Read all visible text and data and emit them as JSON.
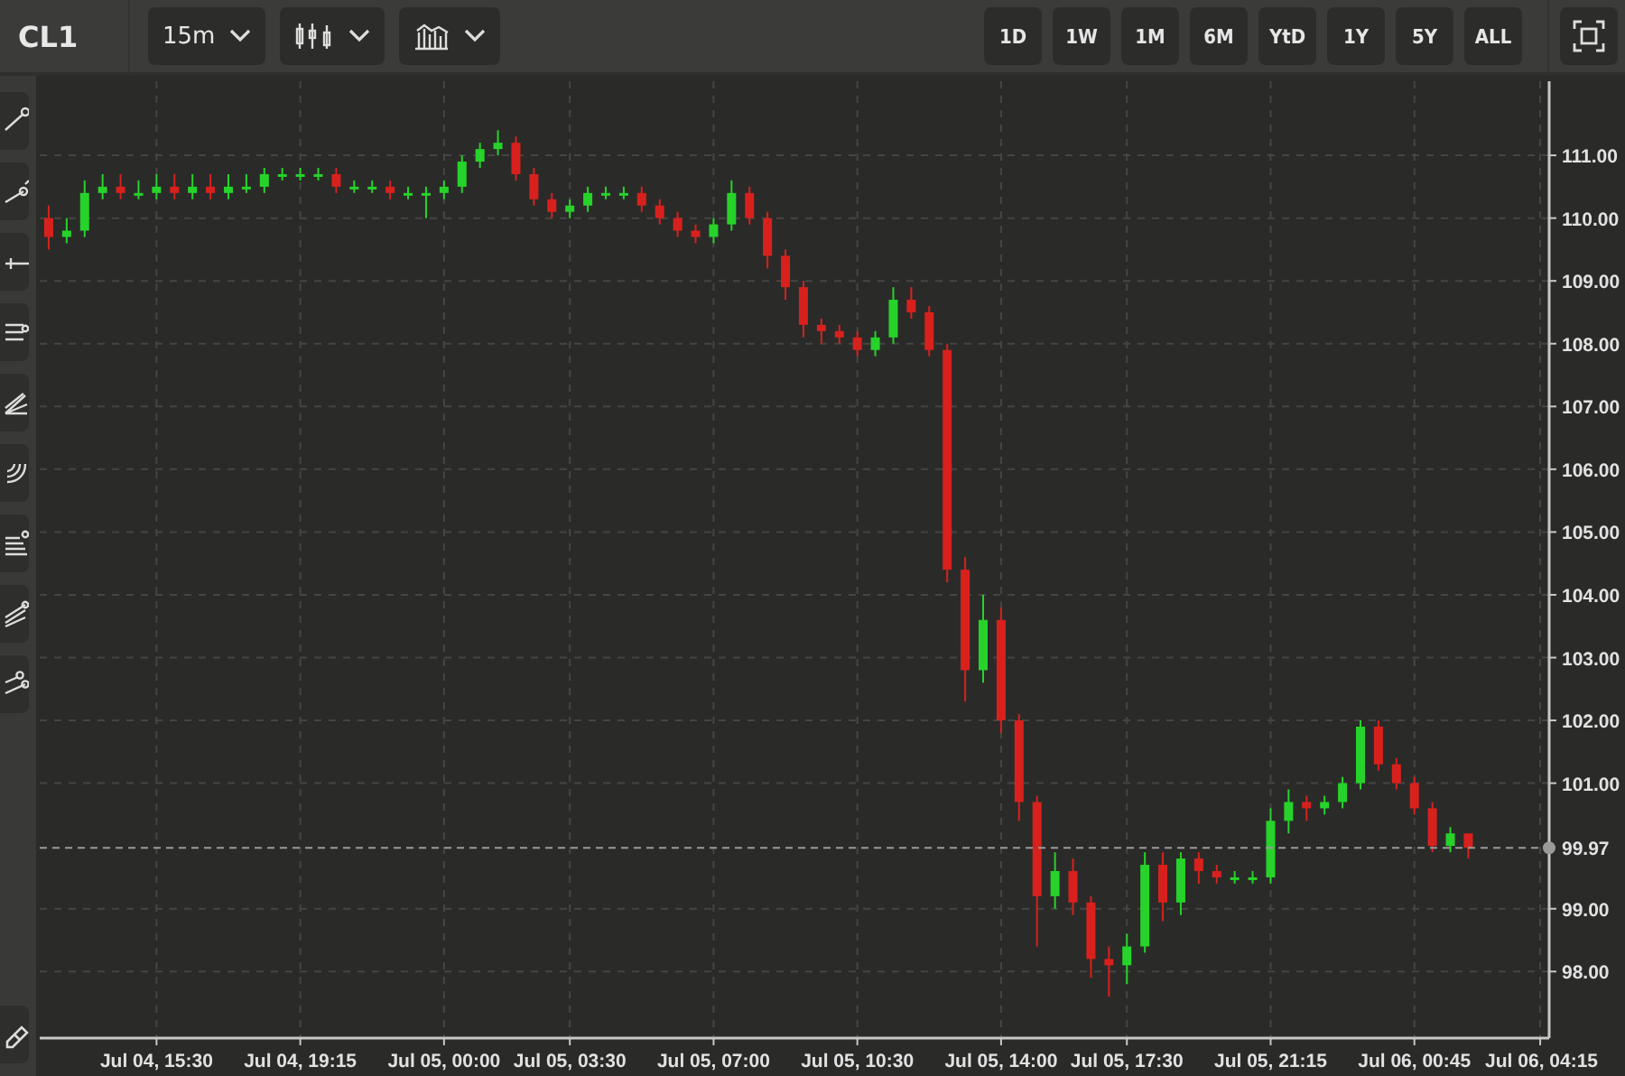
{
  "symbol": "CL1",
  "interval": {
    "label": "15m"
  },
  "ranges": [
    {
      "label": "1D",
      "selected": false
    },
    {
      "label": "1W",
      "selected": false
    },
    {
      "label": "1M",
      "selected": false
    },
    {
      "label": "6M",
      "selected": false
    },
    {
      "label": "YtD",
      "selected": false
    },
    {
      "label": "1Y",
      "selected": false
    },
    {
      "label": "5Y",
      "selected": false
    },
    {
      "label": "ALL",
      "selected": false
    }
  ],
  "chart_data": {
    "type": "candlestick",
    "ylim": [
      96.94,
      112.18
    ],
    "grid": true,
    "ref_lines": [
      {
        "axis": "y",
        "value": 99.97,
        "label": "99.97"
      }
    ],
    "yticks": [
      {
        "value": 98,
        "label": "98.00"
      },
      {
        "value": 99,
        "label": "99.00"
      },
      {
        "value": 101,
        "label": "101.00"
      },
      {
        "value": 102,
        "label": "102.00"
      },
      {
        "value": 103,
        "label": "103.00"
      },
      {
        "value": 104,
        "label": "104.00"
      },
      {
        "value": 105,
        "label": "105.00"
      },
      {
        "value": 106,
        "label": "106.00"
      },
      {
        "value": 107,
        "label": "107.00"
      },
      {
        "value": 108,
        "label": "108.00"
      },
      {
        "value": 109,
        "label": "109.00"
      },
      {
        "value": 110,
        "label": "110.00"
      },
      {
        "value": 111,
        "label": "111.00"
      }
    ],
    "categories": [
      null,
      null,
      null,
      null,
      null,
      null,
      "Jul 04, 15:30",
      null,
      null,
      null,
      null,
      null,
      null,
      null,
      "Jul 04, 19:15",
      null,
      null,
      null,
      null,
      null,
      null,
      null,
      "Jul 05, 00:00",
      null,
      null,
      null,
      null,
      null,
      null,
      "Jul 05, 03:30",
      null,
      null,
      null,
      null,
      null,
      null,
      null,
      "Jul 05, 07:00",
      null,
      null,
      null,
      null,
      null,
      null,
      null,
      "Jul 05, 10:30",
      null,
      null,
      null,
      null,
      null,
      null,
      null,
      "Jul 05, 14:00",
      null,
      null,
      null,
      null,
      null,
      null,
      "Jul 05, 17:30",
      null,
      null,
      null,
      null,
      null,
      null,
      null,
      "Jul 05, 21:15",
      null,
      null,
      null,
      null,
      null,
      null,
      null,
      "Jul 06, 00:45",
      null,
      null,
      null,
      null,
      null,
      null,
      "Jul 06, 04:15"
    ],
    "ohlc": [
      [
        110.0,
        110.2,
        109.5,
        109.7
      ],
      [
        109.7,
        110.0,
        109.6,
        109.8
      ],
      [
        109.8,
        110.6,
        109.7,
        110.4
      ],
      [
        110.4,
        110.7,
        110.3,
        110.5
      ],
      [
        110.5,
        110.7,
        110.3,
        110.4
      ],
      [
        110.4,
        110.6,
        110.3,
        110.4
      ],
      [
        110.4,
        110.7,
        110.3,
        110.5
      ],
      [
        110.5,
        110.7,
        110.3,
        110.4
      ],
      [
        110.4,
        110.7,
        110.3,
        110.5
      ],
      [
        110.5,
        110.7,
        110.3,
        110.4
      ],
      [
        110.4,
        110.7,
        110.3,
        110.5
      ],
      [
        110.5,
        110.7,
        110.4,
        110.5
      ],
      [
        110.5,
        110.8,
        110.4,
        110.7
      ],
      [
        110.7,
        110.8,
        110.6,
        110.7
      ],
      [
        110.7,
        110.8,
        110.6,
        110.7
      ],
      [
        110.7,
        110.8,
        110.6,
        110.7
      ],
      [
        110.7,
        110.8,
        110.4,
        110.5
      ],
      [
        110.5,
        110.6,
        110.4,
        110.5
      ],
      [
        110.5,
        110.6,
        110.4,
        110.5
      ],
      [
        110.5,
        110.6,
        110.3,
        110.4
      ],
      [
        110.4,
        110.5,
        110.3,
        110.4
      ],
      [
        110.4,
        110.5,
        110.0,
        110.4
      ],
      [
        110.4,
        110.6,
        110.3,
        110.5
      ],
      [
        110.5,
        111.0,
        110.4,
        110.9
      ],
      [
        110.9,
        111.2,
        110.8,
        111.1
      ],
      [
        111.1,
        111.4,
        111.0,
        111.2
      ],
      [
        111.2,
        111.3,
        110.6,
        110.7
      ],
      [
        110.7,
        110.8,
        110.2,
        110.3
      ],
      [
        110.3,
        110.4,
        110.0,
        110.1
      ],
      [
        110.1,
        110.3,
        110.0,
        110.2
      ],
      [
        110.2,
        110.5,
        110.1,
        110.4
      ],
      [
        110.4,
        110.5,
        110.3,
        110.4
      ],
      [
        110.4,
        110.5,
        110.3,
        110.4
      ],
      [
        110.4,
        110.5,
        110.1,
        110.2
      ],
      [
        110.2,
        110.3,
        109.9,
        110.0
      ],
      [
        110.0,
        110.1,
        109.7,
        109.8
      ],
      [
        109.8,
        109.9,
        109.6,
        109.7
      ],
      [
        109.7,
        110.0,
        109.6,
        109.9
      ],
      [
        109.9,
        110.6,
        109.8,
        110.4
      ],
      [
        110.4,
        110.5,
        109.9,
        110.0
      ],
      [
        110.0,
        110.1,
        109.2,
        109.4
      ],
      [
        109.4,
        109.5,
        108.7,
        108.9
      ],
      [
        108.9,
        109.0,
        108.1,
        108.3
      ],
      [
        108.3,
        108.4,
        108.0,
        108.2
      ],
      [
        108.2,
        108.3,
        108.0,
        108.1
      ],
      [
        108.1,
        108.2,
        107.8,
        107.9
      ],
      [
        107.9,
        108.2,
        107.8,
        108.1
      ],
      [
        108.1,
        108.9,
        108.0,
        108.7
      ],
      [
        108.7,
        108.9,
        108.4,
        108.5
      ],
      [
        108.5,
        108.6,
        107.8,
        107.9
      ],
      [
        107.9,
        108.0,
        104.2,
        104.4
      ],
      [
        104.4,
        104.6,
        102.3,
        102.8
      ],
      [
        102.8,
        104.0,
        102.6,
        103.6
      ],
      [
        103.6,
        103.8,
        101.8,
        102.0
      ],
      [
        102.0,
        102.1,
        100.4,
        100.7
      ],
      [
        100.7,
        100.8,
        98.4,
        99.2
      ],
      [
        99.2,
        99.9,
        99.0,
        99.6
      ],
      [
        99.6,
        99.8,
        98.9,
        99.1
      ],
      [
        99.1,
        99.2,
        97.9,
        98.2
      ],
      [
        98.2,
        98.4,
        97.6,
        98.1
      ],
      [
        98.1,
        98.6,
        97.8,
        98.4
      ],
      [
        98.4,
        99.9,
        98.3,
        99.7
      ],
      [
        99.7,
        99.9,
        98.8,
        99.1
      ],
      [
        99.1,
        99.9,
        98.9,
        99.8
      ],
      [
        99.8,
        99.9,
        99.4,
        99.6
      ],
      [
        99.6,
        99.7,
        99.4,
        99.5
      ],
      [
        99.5,
        99.6,
        99.4,
        99.5
      ],
      [
        99.5,
        99.6,
        99.4,
        99.5
      ],
      [
        99.5,
        100.6,
        99.4,
        100.4
      ],
      [
        100.4,
        100.9,
        100.2,
        100.7
      ],
      [
        100.7,
        100.8,
        100.4,
        100.6
      ],
      [
        100.6,
        100.8,
        100.5,
        100.7
      ],
      [
        100.7,
        101.1,
        100.6,
        101.0
      ],
      [
        101.0,
        102.0,
        100.9,
        101.9
      ],
      [
        101.9,
        102.0,
        101.2,
        101.3
      ],
      [
        101.3,
        101.4,
        100.9,
        101.0
      ],
      [
        101.0,
        101.1,
        100.5,
        100.6
      ],
      [
        100.6,
        100.7,
        99.9,
        100.0
      ],
      [
        100.0,
        100.3,
        99.9,
        100.2
      ],
      [
        100.2,
        100.2,
        99.8,
        99.97
      ],
      null,
      null,
      null,
      null
    ]
  }
}
